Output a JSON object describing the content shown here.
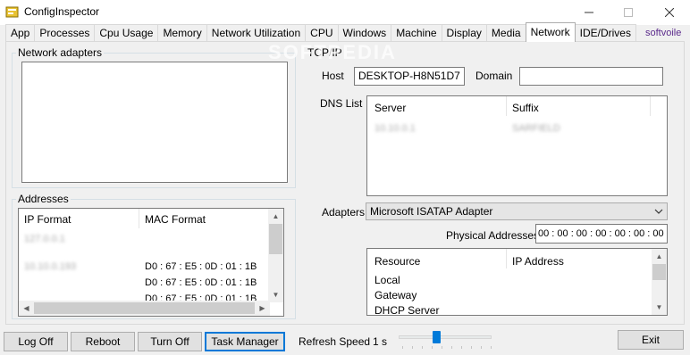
{
  "window": {
    "title": "ConfigInspector"
  },
  "tabs": [
    "App",
    "Processes",
    "Cpu Usage",
    "Memory",
    "Network Utilization",
    "CPU",
    "Windows",
    "Machine",
    "Display",
    "Media",
    "Network",
    "IDE/Drives"
  ],
  "active_tab": "Network",
  "brand": "softvoile",
  "watermark": "SOFTPEDIA",
  "network_adapters": {
    "label": "Network adapters"
  },
  "addresses": {
    "label": "Addresses",
    "columns": [
      "IP Format",
      "MAC Format"
    ],
    "rows": [
      {
        "ip": "127.0.0.1",
        "mac": ""
      },
      {
        "ip": "10.10.0.193",
        "mac": "D0 : 67 : E5 : 0D : 01 : 1B"
      },
      {
        "ip": "",
        "mac": "D0 : 67 : E5 : 0D : 01 : 1B"
      },
      {
        "ip": "",
        "mac": "D0 : 67 : E5 : 0D : 01 : 1B"
      }
    ]
  },
  "tcpip": {
    "label": "TCP/IP",
    "host_label": "Host",
    "host_value": "DESKTOP-H8N51D7",
    "domain_label": "Domain",
    "domain_value": "",
    "dns_label": "DNS List",
    "dns_columns": [
      "Server",
      "Suffix"
    ],
    "dns_rows": [
      {
        "server": "10.10.0.1",
        "suffix": "SARFIELD"
      }
    ],
    "adapters_label": "Adapters",
    "adapter_selected": "Microsoft ISATAP Adapter",
    "physical_label": "Physical  Addresses",
    "physical_value": "00 : 00 : 00 : 00 : 00 : 00 : 00 : 00",
    "resource_columns": [
      "Resource",
      "IP Address"
    ],
    "resource_rows": [
      "Local",
      "Gateway",
      "DHCP Server"
    ]
  },
  "bottom": {
    "logoff": "Log Off",
    "reboot": "Reboot",
    "turnoff": "Turn Off",
    "taskmanager": "Task Manager",
    "refresh_label": "Refresh Speed",
    "refresh_value": "1 s",
    "refresh_level": 0.4,
    "exit": "Exit"
  }
}
